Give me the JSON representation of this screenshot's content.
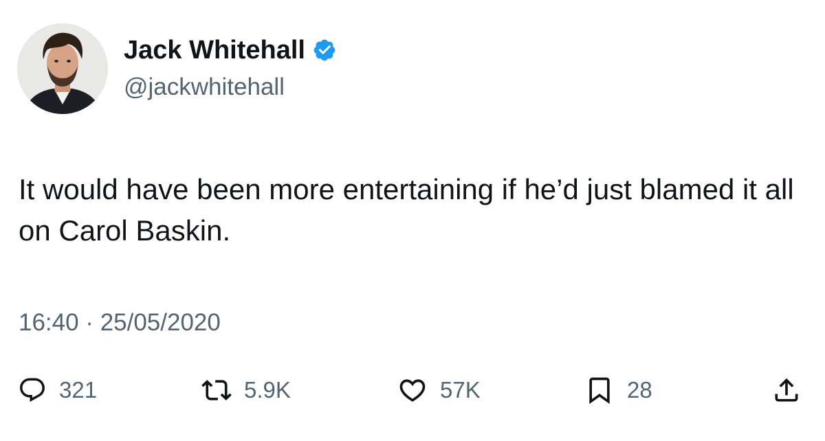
{
  "author": {
    "display_name": "Jack Whitehall",
    "handle": "@jackwhitehall",
    "verified": true,
    "verified_color": "#1d9bf0"
  },
  "tweet": {
    "text": "It would have been more entertaining if he’d just blamed it all on Carol Baskin.",
    "timestamp": "16:40 · 25/05/2020"
  },
  "actions": {
    "reply": {
      "icon": "reply-icon",
      "count": "321"
    },
    "retweet": {
      "icon": "retweet-icon",
      "count": "5.9K"
    },
    "like": {
      "icon": "heart-icon",
      "count": "57K"
    },
    "bookmark": {
      "icon": "bookmark-icon",
      "count": "28"
    },
    "share": {
      "icon": "share-icon"
    }
  },
  "colors": {
    "text_primary": "#0f1419",
    "text_secondary": "#536471",
    "accent": "#1d9bf0"
  }
}
